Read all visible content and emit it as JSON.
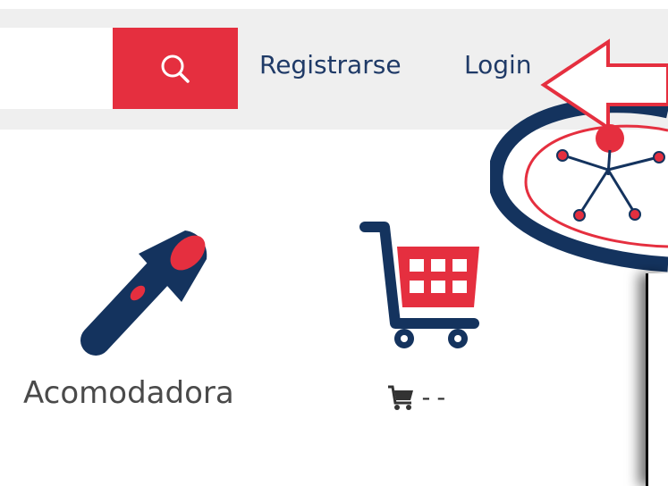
{
  "header": {
    "search": {
      "placeholder": "",
      "button_icon": "search-icon",
      "button_color": "#e52f3f"
    },
    "links": {
      "register": "Registrarse",
      "login": "Login"
    },
    "annotation": {
      "icon": "left-arrow-icon",
      "color": "#e52f3f"
    }
  },
  "logo": {
    "icon": "stick-figure-logo",
    "colors": [
      "#14335e",
      "#e52f3f"
    ]
  },
  "tiles": [
    {
      "icon": "flashlight-icon",
      "label": "Acomodadora"
    },
    {
      "icon": "shopping-cart-icon",
      "label": "--"
    }
  ],
  "colors": {
    "brand_navy": "#14335e",
    "brand_red": "#e52f3f",
    "link_text": "#1f3a67",
    "band_bg": "#efefef"
  }
}
